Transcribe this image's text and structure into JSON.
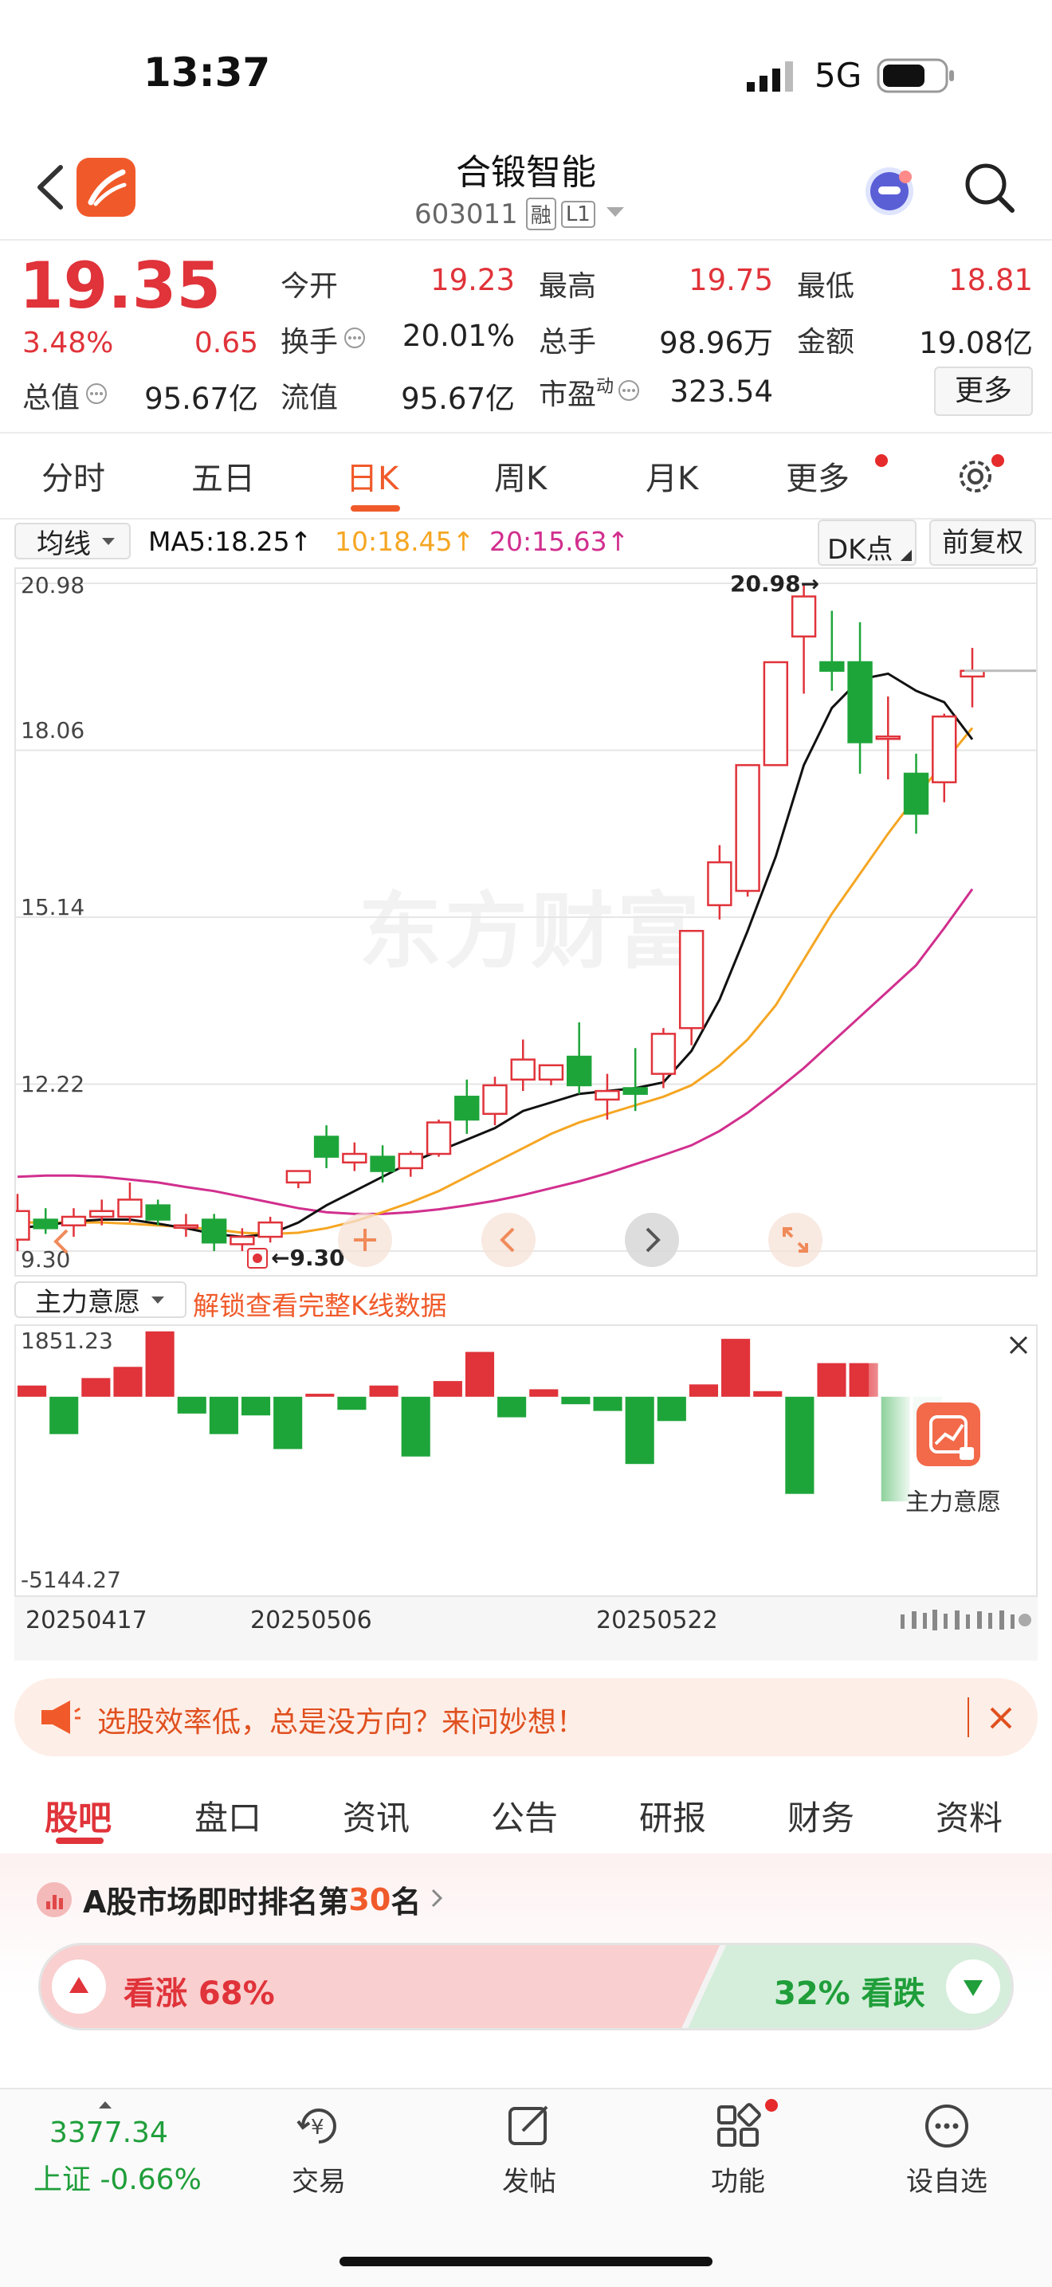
{
  "status_bar": {
    "time": "13:37",
    "network": "5G"
  },
  "header": {
    "stock_name": "合锻智能",
    "code": "603011",
    "badge_rong": "融",
    "badge_level": "L1"
  },
  "quote": {
    "price": "19.35",
    "change_pct": "3.48%",
    "change_abs": "0.65",
    "stats": [
      {
        "label": "今开",
        "value": "19.23",
        "color": "red"
      },
      {
        "label": "最高",
        "value": "19.75",
        "color": "red"
      },
      {
        "label": "最低",
        "value": "18.81",
        "color": "red"
      },
      {
        "label": "换手",
        "value": "20.01%",
        "color": "black"
      },
      {
        "label": "总手",
        "value": "98.96万",
        "color": "black"
      },
      {
        "label": "金额",
        "value": "19.08亿",
        "color": "black"
      },
      {
        "label": "总值",
        "value": "95.67亿",
        "color": "black"
      },
      {
        "label": "流值",
        "value": "95.67亿",
        "color": "black"
      },
      {
        "label": "市盈",
        "sup": "动",
        "value": "323.54",
        "color": "black"
      }
    ],
    "more_button": "更多"
  },
  "period_tabs": [
    "分时",
    "五日",
    "日K",
    "周K",
    "月K",
    "更多"
  ],
  "active_period": "日K",
  "indicators": {
    "ma_select": "均线",
    "ma5": "MA5:18.25↑",
    "ma10": "10:18.45↑",
    "ma20": "20:15.63↑",
    "dk_button": "DK点",
    "adjust_button": "前复权"
  },
  "price_axis": [
    "20.98",
    "18.06",
    "15.14",
    "12.22",
    "9.30"
  ],
  "chart_annotations": {
    "high": "20.98→",
    "low": "←9.30"
  },
  "watermark": "东方财富",
  "sub_indicator": {
    "select": "主力意愿",
    "unlock_text": "解锁查看完整K线数据",
    "axis_top": "1851.23",
    "axis_bottom": "-5144.27",
    "lock_card_label": "主力意愿"
  },
  "date_axis": [
    "20250417",
    "20250506",
    "20250522"
  ],
  "colors": {
    "up": "#e0333a",
    "down": "#1ea53a",
    "ma5": "#111111",
    "ma10": "#f5a623",
    "ma20": "#d12f8e",
    "accent": "#f05a2a"
  },
  "chart_data": {
    "type": "candlestick",
    "ylim": [
      9.3,
      20.98
    ],
    "candles": [
      {
        "o": 9.5,
        "h": 10.3,
        "l": 9.3,
        "c": 10.0
      },
      {
        "o": 9.85,
        "h": 10.05,
        "l": 9.6,
        "c": 9.7
      },
      {
        "o": 9.75,
        "h": 10.05,
        "l": 9.55,
        "c": 9.9
      },
      {
        "o": 9.9,
        "h": 10.2,
        "l": 9.75,
        "c": 10.0
      },
      {
        "o": 9.9,
        "h": 10.5,
        "l": 9.8,
        "c": 10.2
      },
      {
        "o": 10.1,
        "h": 10.2,
        "l": 9.75,
        "c": 9.85
      },
      {
        "o": 9.75,
        "h": 9.95,
        "l": 9.55,
        "c": 9.75
      },
      {
        "o": 9.85,
        "h": 9.95,
        "l": 9.3,
        "c": 9.45
      },
      {
        "o": 9.42,
        "h": 9.7,
        "l": 9.3,
        "c": 9.55
      },
      {
        "o": 9.55,
        "h": 9.9,
        "l": 9.45,
        "c": 9.8
      },
      {
        "o": 10.5,
        "h": 10.7,
        "l": 10.4,
        "c": 10.7
      },
      {
        "o": 11.3,
        "h": 11.5,
        "l": 10.75,
        "c": 10.95
      },
      {
        "o": 10.85,
        "h": 11.2,
        "l": 10.7,
        "c": 11.0
      },
      {
        "o": 10.95,
        "h": 11.15,
        "l": 10.5,
        "c": 10.7
      },
      {
        "o": 10.75,
        "h": 11.05,
        "l": 10.6,
        "c": 11.0
      },
      {
        "o": 11.0,
        "h": 11.6,
        "l": 10.95,
        "c": 11.55
      },
      {
        "o": 12.0,
        "h": 12.3,
        "l": 11.35,
        "c": 11.6
      },
      {
        "o": 11.7,
        "h": 12.35,
        "l": 11.5,
        "c": 12.2
      },
      {
        "o": 12.3,
        "h": 13.0,
        "l": 12.1,
        "c": 12.65
      },
      {
        "o": 12.3,
        "h": 12.55,
        "l": 12.2,
        "c": 12.55
      },
      {
        "o": 12.7,
        "h": 13.3,
        "l": 12.05,
        "c": 12.2
      },
      {
        "o": 11.95,
        "h": 12.4,
        "l": 11.6,
        "c": 12.1
      },
      {
        "o": 12.15,
        "h": 12.85,
        "l": 11.75,
        "c": 12.05
      },
      {
        "o": 12.4,
        "h": 13.2,
        "l": 12.15,
        "c": 13.1
      },
      {
        "o": 13.2,
        "h": 14.9,
        "l": 12.9,
        "c": 14.9
      },
      {
        "o": 15.35,
        "h": 16.4,
        "l": 15.1,
        "c": 16.1
      },
      {
        "o": 15.6,
        "h": 17.8,
        "l": 15.5,
        "c": 17.8
      },
      {
        "o": 17.8,
        "h": 19.6,
        "l": 17.8,
        "c": 19.6
      },
      {
        "o": 20.05,
        "h": 20.98,
        "l": 19.05,
        "c": 20.75
      },
      {
        "o": 19.6,
        "h": 20.5,
        "l": 19.1,
        "c": 19.45
      },
      {
        "o": 19.6,
        "h": 20.3,
        "l": 17.65,
        "c": 18.2
      },
      {
        "o": 18.3,
        "h": 19.0,
        "l": 17.55,
        "c": 18.3
      },
      {
        "o": 17.65,
        "h": 18.0,
        "l": 16.6,
        "c": 16.95
      },
      {
        "o": 17.5,
        "h": 18.7,
        "l": 17.15,
        "c": 18.65
      },
      {
        "o": 19.35,
        "h": 19.85,
        "l": 18.81,
        "c": 19.45
      }
    ],
    "ma5": [
      9.7,
      9.75,
      9.82,
      9.85,
      9.85,
      9.78,
      9.7,
      9.6,
      9.55,
      9.6,
      9.8,
      10.1,
      10.35,
      10.6,
      10.85,
      11.05,
      11.25,
      11.45,
      11.75,
      11.9,
      12.05,
      12.1,
      12.15,
      12.25,
      12.8,
      13.7,
      14.9,
      16.2,
      17.8,
      18.8,
      19.3,
      19.4,
      19.1,
      18.9,
      18.25
    ],
    "ma10": [
      9.8,
      9.8,
      9.8,
      9.8,
      9.78,
      9.75,
      9.72,
      9.68,
      9.62,
      9.6,
      9.62,
      9.7,
      9.82,
      9.98,
      10.15,
      10.35,
      10.6,
      10.85,
      11.1,
      11.35,
      11.55,
      11.7,
      11.85,
      12.0,
      12.2,
      12.55,
      13.0,
      13.6,
      14.4,
      15.2,
      15.9,
      16.6,
      17.25,
      17.85,
      18.45
    ],
    "ma20": [
      10.6,
      10.62,
      10.62,
      10.6,
      10.55,
      10.5,
      10.42,
      10.35,
      10.25,
      10.15,
      10.05,
      9.98,
      9.95,
      9.95,
      9.98,
      10.03,
      10.1,
      10.18,
      10.28,
      10.4,
      10.52,
      10.66,
      10.82,
      10.98,
      11.15,
      11.4,
      11.72,
      12.1,
      12.5,
      12.95,
      13.4,
      13.85,
      14.3,
      14.95,
      15.63
    ]
  },
  "sub_chart_data": {
    "type": "bar",
    "ylim": [
      -5144.27,
      1851.23
    ],
    "values": [
      300,
      -1000,
      500,
      800,
      1750,
      -450,
      -1000,
      -500,
      -1400,
      80,
      -350,
      300,
      -1600,
      420,
      1200,
      -550,
      200,
      -200,
      -380,
      -1800,
      -650,
      330,
      1550,
      150,
      -2600,
      900,
      900,
      -2800,
      -1500
    ]
  },
  "promo": {
    "text": "选股效率低，总是没方向？来问妙想！"
  },
  "bottom_tabs": [
    "股吧",
    "盘口",
    "资讯",
    "公告",
    "研报",
    "财务",
    "资料"
  ],
  "ranking": {
    "prefix": "A股市场即时排名第",
    "rank": "30",
    "suffix": "名"
  },
  "sentiment": {
    "up_label": "看涨 68%",
    "down_label": "32% 看跌",
    "up_pct": 68
  },
  "bottom_nav": {
    "index_value": "3377.34",
    "index_label": "上证 -0.66%",
    "items": [
      "交易",
      "发帖",
      "功能",
      "设自选"
    ]
  }
}
